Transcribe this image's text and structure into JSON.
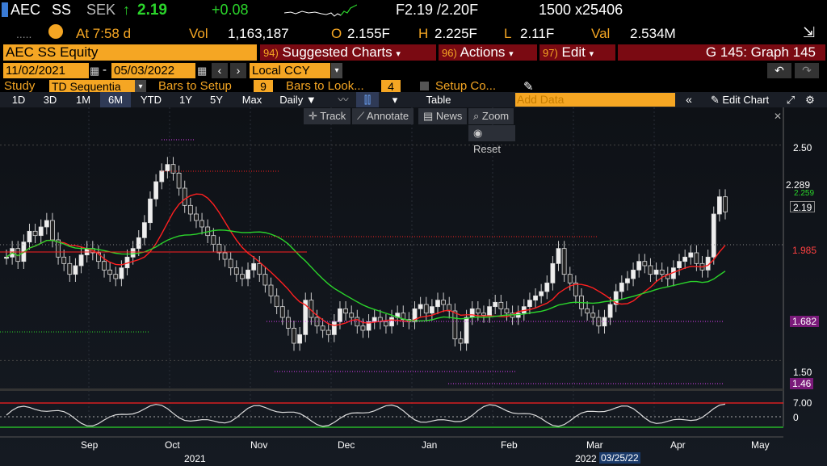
{
  "quote": {
    "ticker": "AEC",
    "exchange": "SS",
    "currency": "SEK",
    "arrow": "↑",
    "last": "2.19",
    "change": "+0.08",
    "bid_ask": "F2.19 /2.20F",
    "size": "1500 x25406",
    "time_label": "At 7:58 d",
    "vol_label": "Vol",
    "vol": "1,163,187",
    "open_label": "O",
    "open": "2.155F",
    "high_label": "H",
    "high": "2.225F",
    "low_label": "L",
    "low": "2.11F",
    "val_label": "Val",
    "val": "2.534M"
  },
  "security": {
    "name": "AEC SS Equity",
    "menu_suggested": "Suggested Charts",
    "menu_suggested_num": "94)",
    "menu_actions": "Actions",
    "menu_actions_num": "96)",
    "menu_edit": "Edit",
    "menu_edit_num": "97)",
    "graph_label": "G 145: Graph 145"
  },
  "dates": {
    "start": "11/02/2021",
    "end": "05/03/2022",
    "currency": "Local CCY"
  },
  "study": {
    "label": "Study",
    "value": "TD Sequentia",
    "bars_setup_label": "Bars to Setup",
    "bars_setup": "9",
    "bars_look_label": "Bars to Look...",
    "bars_look": "4",
    "setup_co_label": "Setup Co..."
  },
  "periods": [
    "1D",
    "3D",
    "1M",
    "6M",
    "YTD",
    "1Y",
    "5Y",
    "Max"
  ],
  "selected_period": "6M",
  "frequency": "Daily",
  "table_label": "Table",
  "add_data_placeholder": "Add Data",
  "edit_chart_label": "Edit Chart",
  "chart_tools": {
    "track": "Track",
    "annotate": "Annotate",
    "news": "News",
    "zoom": "Zoom",
    "reset": "Reset"
  },
  "colors": {
    "accent": "#f5a623",
    "menu": "#7a0a12",
    "up": "#2bd52b",
    "down": "#ff2020",
    "magenta": "#e040fb"
  },
  "chart_data": {
    "type": "candlestick",
    "y_ticks": [
      "2.50",
      "1.50",
      "7.00",
      "0"
    ],
    "price_tags": [
      {
        "label": "2.289",
        "color": "#ffffff",
        "bg": "#1a3a6a"
      },
      {
        "label": "2.259",
        "color": "#2bd52b",
        "bg": "#000"
      },
      {
        "label": "2.19",
        "color": "#ffffff",
        "bg": "#000"
      },
      {
        "label": "1.985",
        "color": "#ff4040",
        "bg": "#000"
      },
      {
        "label": "1.682",
        "color": "#ffffff",
        "bg": "#7a1a7a"
      },
      {
        "label": "1.46",
        "color": "#ffffff",
        "bg": "#7a1a7a"
      }
    ],
    "x_months": [
      "Sep",
      "Oct",
      "Nov",
      "Dec",
      "Jan",
      "Feb",
      "Mar",
      "Apr",
      "May"
    ],
    "x_years": [
      "2021",
      "2022"
    ],
    "cursor_date": "03/25/22",
    "ylim": [
      1.4,
      2.6
    ],
    "closes": [
      1.98,
      2.02,
      1.96,
      2.05,
      2.1,
      2.08,
      2.12,
      2.15,
      2.06,
      1.98,
      1.95,
      1.9,
      1.94,
      1.99,
      2.02,
      2.0,
      1.96,
      1.92,
      1.9,
      1.88,
      1.93,
      1.98,
      2.02,
      2.07,
      2.14,
      2.25,
      2.33,
      2.38,
      2.41,
      2.37,
      2.3,
      2.22,
      2.18,
      2.15,
      2.12,
      2.08,
      2.04,
      2.0,
      1.97,
      1.93,
      1.9,
      1.88,
      1.92,
      1.95,
      1.9,
      1.85,
      1.8,
      1.75,
      1.7,
      1.65,
      1.58,
      1.62,
      1.78,
      1.7,
      1.66,
      1.64,
      1.62,
      1.68,
      1.74,
      1.72,
      1.7,
      1.66,
      1.64,
      1.68,
      1.7,
      1.68,
      1.66,
      1.7,
      1.72,
      1.69,
      1.68,
      1.74,
      1.76,
      1.72,
      1.75,
      1.78,
      1.76,
      1.73,
      1.6,
      1.58,
      1.7,
      1.74,
      1.72,
      1.71,
      1.75,
      1.77,
      1.74,
      1.72,
      1.7,
      1.72,
      1.75,
      1.78,
      1.8,
      1.82,
      1.86,
      1.95,
      2.02,
      1.9,
      1.86,
      1.8,
      1.74,
      1.72,
      1.7,
      1.66,
      1.7,
      1.76,
      1.82,
      1.86,
      1.88,
      1.92,
      1.96,
      1.94,
      1.9,
      1.92,
      1.9,
      1.88,
      1.93,
      1.96,
      1.98,
      2.0,
      1.95,
      1.92,
      1.98,
      2.18,
      2.26,
      2.19
    ]
  }
}
